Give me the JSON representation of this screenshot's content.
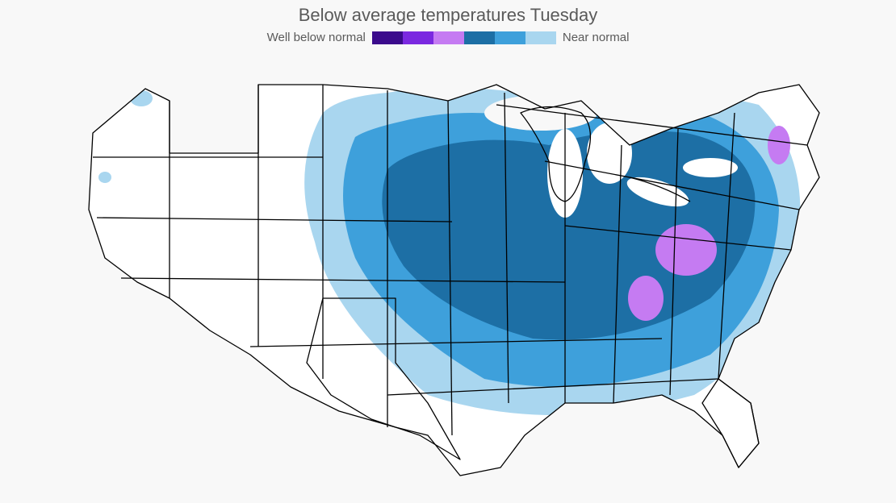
{
  "title": "Below average temperatures Tuesday",
  "legend": {
    "left_label": "Well below normal",
    "right_label": "Near normal",
    "swatches": [
      {
        "name": "level-1",
        "color": "#3b0b8c"
      },
      {
        "name": "level-2",
        "color": "#7b29e0"
      },
      {
        "name": "level-3",
        "color": "#c57bf2"
      },
      {
        "name": "level-4",
        "color": "#1d6fa5"
      },
      {
        "name": "level-5",
        "color": "#3ea0db"
      },
      {
        "name": "level-6",
        "color": "#a9d6ef"
      }
    ]
  },
  "map": {
    "region": "Contiguous United States",
    "projection": "flat",
    "overlay_description": "Temperature anomaly — cooler shades across the eastern two-thirds of the US",
    "zones": [
      {
        "level": "near-normal",
        "color": "#a9d6ef",
        "approx_area": "outer fringe: northern Plains, western Dakotas, Texas panhandle edge, Gulf coastal belt, Carolina/Georgia coast, New England tip; small coastal specks in WA/OR/CA"
      },
      {
        "level": "below",
        "color": "#3ea0db",
        "approx_area": "broad band: eastern Plains, mid-Mississippi valley, Deep South, Carolinas"
      },
      {
        "level": "well-below",
        "color": "#1d6fa5",
        "approx_area": "core: KS/NE through MO-IL-IN-OH-KY-TN-WV-VA-PA-NY-New England and Upper Midwest around the Great Lakes"
      },
      {
        "level": "much-below",
        "color": "#c57bf2",
        "approx_area": "pockets over WV/eastern OH, eastern TN/SW VA, and NH/VT interior"
      }
    ]
  }
}
